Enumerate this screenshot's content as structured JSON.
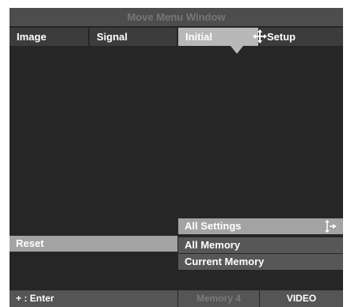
{
  "window": {
    "title": "Move Menu Window"
  },
  "tabs": [
    {
      "label": "Image",
      "active": false
    },
    {
      "label": "Signal",
      "active": false
    },
    {
      "label": "Initial",
      "active": true
    },
    {
      "label": "Setup",
      "active": false
    }
  ],
  "left_menu": {
    "reset_label": "Reset"
  },
  "options": [
    {
      "label": "All Settings",
      "selected": true
    },
    {
      "label": "All Memory",
      "selected": false
    },
    {
      "label": "Current Memory",
      "selected": false
    }
  ],
  "status_bar": {
    "enter_hint": "+ : Enter",
    "memory": "Memory 4",
    "source": "VIDEO"
  },
  "icons": {
    "active_tab_icon": "move-arrows-icon",
    "selected_option_icon": "up-down-right-arrow-icon"
  },
  "colors": {
    "background": "#262626",
    "title_bar": "#4d4d4d",
    "tab": "#3c3c3c",
    "active_tab": "#b8b8b8",
    "highlight": "#a3a3a3",
    "option": "#575757",
    "status_bar": "#555555",
    "dim_text": "#767676"
  }
}
